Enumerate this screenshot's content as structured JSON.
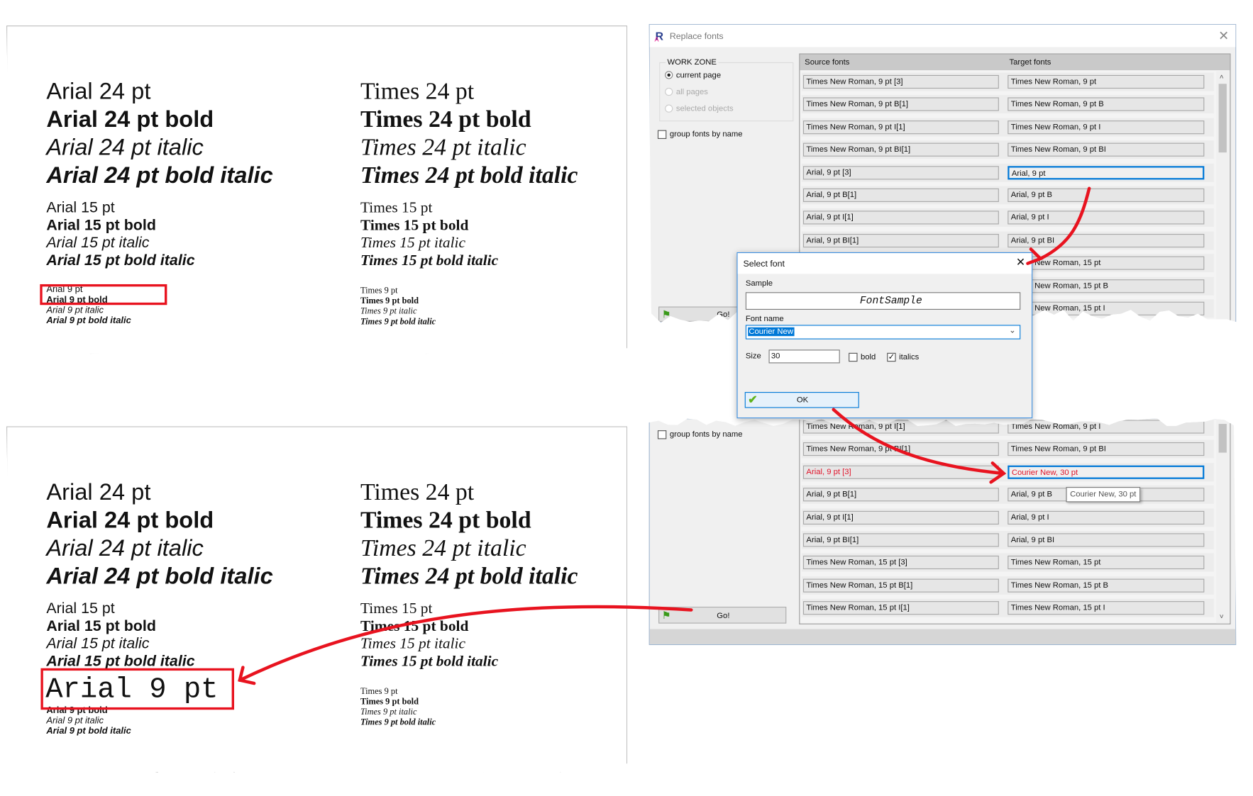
{
  "document_page": {
    "arial_24": [
      "Arial 24 pt",
      "Arial 24 pt bold",
      "Arial 24 pt italic",
      "Arial 24 pt bold italic"
    ],
    "times_24": [
      "Times 24 pt",
      "Times 24 pt bold",
      "Times 24 pt italic",
      "Times 24 pt bold italic"
    ],
    "arial_15": [
      "Arial 15 pt",
      "Arial 15 pt bold",
      "Arial 15 pt italic",
      "Arial 15 pt bold italic"
    ],
    "times_15": [
      "Times 15 pt",
      "Times 15 pt bold",
      "Times 15 pt italic",
      "Times 15 pt bold italic"
    ],
    "arial_9": [
      "Arial 9 pt",
      "Arial 9 pt bold",
      "Arial 9 pt italic",
      "Arial 9 pt bold italic"
    ],
    "times_9": [
      "Times 9 pt",
      "Times 9 pt bold",
      "Times 9 pt italic",
      "Times 9 pt bold italic"
    ],
    "replaced_text": "Arial 9 pt"
  },
  "replace_fonts_dialog": {
    "title": "Replace fonts",
    "work_zone": {
      "label": "WORK ZONE",
      "options": [
        {
          "label": "current page",
          "selected": true,
          "enabled": true
        },
        {
          "label": "all pages",
          "selected": false,
          "enabled": false
        },
        {
          "label": "selected objects",
          "selected": false,
          "enabled": false
        }
      ]
    },
    "group_fonts_by_name": {
      "label": "group fonts by name",
      "checked": false
    },
    "go_button": "Go!",
    "columns": {
      "source": "Source fonts",
      "target": "Target fonts"
    },
    "rows_before": [
      {
        "source": "Times New Roman, 9 pt [3]",
        "target": "Times New Roman, 9 pt"
      },
      {
        "source": "Times New Roman, 9 pt B[1]",
        "target": "Times New Roman, 9 pt B"
      },
      {
        "source": "Times New Roman, 9 pt I[1]",
        "target": "Times New Roman, 9 pt I"
      },
      {
        "source": "Times New Roman, 9 pt BI[1]",
        "target": "Times New Roman, 9 pt BI"
      },
      {
        "source": "Arial, 9 pt [3]",
        "target": "Arial, 9 pt",
        "focused": true
      },
      {
        "source": "Arial, 9 pt B[1]",
        "target": "Arial, 9 pt B"
      },
      {
        "source": "Arial, 9 pt I[1]",
        "target": "Arial, 9 pt I"
      },
      {
        "source": "Arial, 9 pt BI[1]",
        "target": "Arial, 9 pt BI"
      },
      {
        "source": "",
        "target": "Times New Roman, 15 pt"
      },
      {
        "source": "",
        "target": "Times New Roman, 15 pt B"
      },
      {
        "source": "",
        "target": "Times New Roman, 15 pt I"
      }
    ],
    "rows_after": [
      {
        "source": "Times New Roman, 9 pt I[1]",
        "target": "Times New Roman, 9 pt I"
      },
      {
        "source": "Times New Roman, 9 pt BI[1]",
        "target": "Times New Roman, 9 pt BI"
      },
      {
        "source": "Arial, 9 pt [3]",
        "target": "Courier New, 30 pt",
        "changed": true
      },
      {
        "source": "Arial, 9 pt B[1]",
        "target": "Arial, 9 pt B"
      },
      {
        "source": "Arial, 9 pt I[1]",
        "target": "Arial, 9 pt I"
      },
      {
        "source": "Arial, 9 pt BI[1]",
        "target": "Arial, 9 pt BI"
      },
      {
        "source": "Times New Roman, 15 pt [3]",
        "target": "Times New Roman, 15 pt"
      },
      {
        "source": "Times New Roman, 15 pt B[1]",
        "target": "Times New Roman, 15 pt B"
      },
      {
        "source": "Times New Roman, 15 pt I[1]",
        "target": "Times New Roman, 15 pt I"
      }
    ],
    "tooltip": "Courier New, 30 pt"
  },
  "select_font_dialog": {
    "title": "Select font",
    "sample_label": "Sample",
    "sample_text": "FontSample",
    "font_name_label": "Font name",
    "font_name_value": "Courier New",
    "size_label": "Size",
    "size_value": "30",
    "bold": {
      "label": "bold",
      "checked": false
    },
    "italics": {
      "label": "italics",
      "checked": true
    },
    "ok_button": "OK"
  },
  "colors": {
    "highlight": "#e8131f",
    "focus": "#0078d7",
    "changed_text": "#e0142a"
  },
  "icons": {
    "app": "replace-fonts-logo-icon",
    "go": "green-flag-icon",
    "ok": "green-check-icon",
    "close": "close-icon"
  }
}
